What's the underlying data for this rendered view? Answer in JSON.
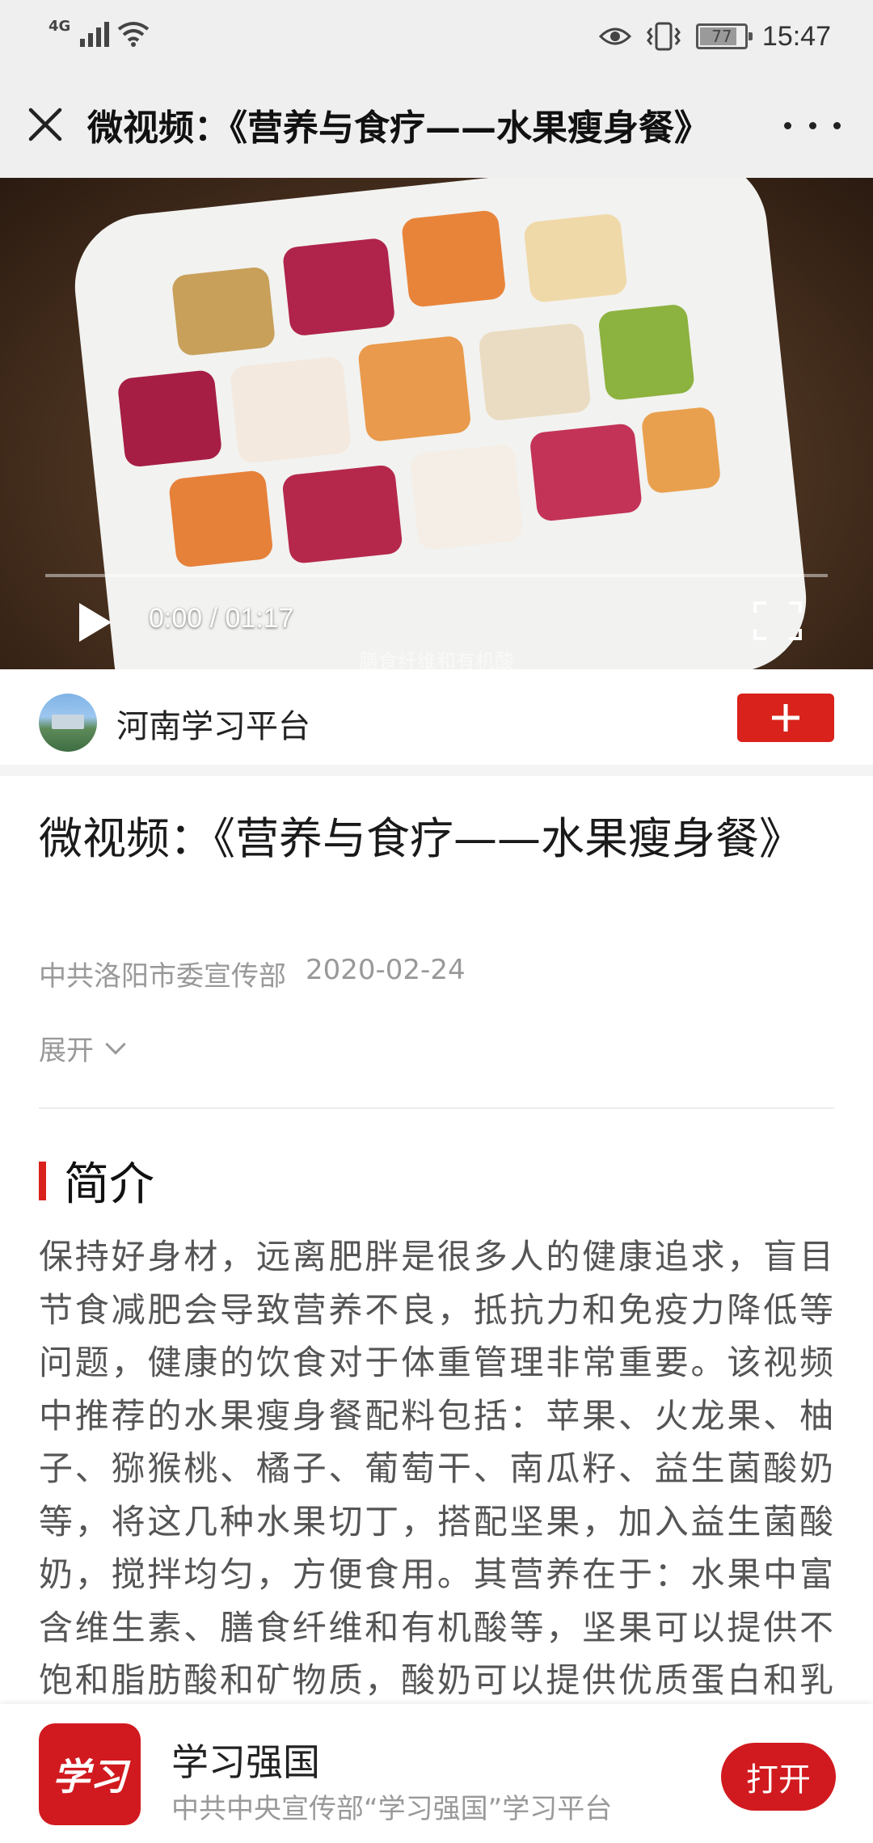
{
  "status_bar": {
    "network": "4G",
    "battery": "77",
    "battery_level": 0.77,
    "time": "15:47",
    "icons": [
      "signal-icon",
      "wifi-icon",
      "eye-icon",
      "vibrate-icon",
      "battery-icon"
    ]
  },
  "title_bar": {
    "title": "微视频：《营养与食疗——水果瘦身餐》",
    "close_icon": "close-icon",
    "more_icon": "more-icon"
  },
  "video": {
    "time": "0:00 / 01:17",
    "progress": 0,
    "subtitle": "膳食纤维和有机酸",
    "play_icon": "play-icon",
    "fullscreen_icon": "fullscreen-icon"
  },
  "channel": {
    "name": "河南学习平台",
    "follow_icon": "plus-icon"
  },
  "article": {
    "title": "微视频：《营养与食疗——水果瘦身餐》",
    "source": "中共洛阳市委宣传部",
    "date": "2020-02-24",
    "expand_label": "展开",
    "section_title": "简介",
    "body": "保持好身材，远离肥胖是很多人的健康追求，盲目节食减肥会导致营养不良，抵抗力和免疫力降低等问题，健康的饮食对于体重管理非常重要。该视频中推荐的水果瘦身餐配料包括：苹果、火龙果、柚子、猕猴桃、橘子、葡萄干、南瓜籽、益生菌酸奶等，将这几种水果切丁，搭配坚果，加入益生菌酸奶，搅拌均匀，方便食用。其营养在于：水果中富含维生素、膳食纤维和有机酸等，坚果可以提供不饱和脂肪酸和矿物质，酸奶可以提供优质蛋白和乳酸菌，互相搭配，"
  },
  "banner": {
    "logo_text": "学习",
    "app_name": "学习强国",
    "app_desc": "中共中央宣传部“学习强国”学习平台",
    "open_label": "打开"
  },
  "colors": {
    "accent": "#d9221b",
    "banner_red": "#d11a1f"
  }
}
